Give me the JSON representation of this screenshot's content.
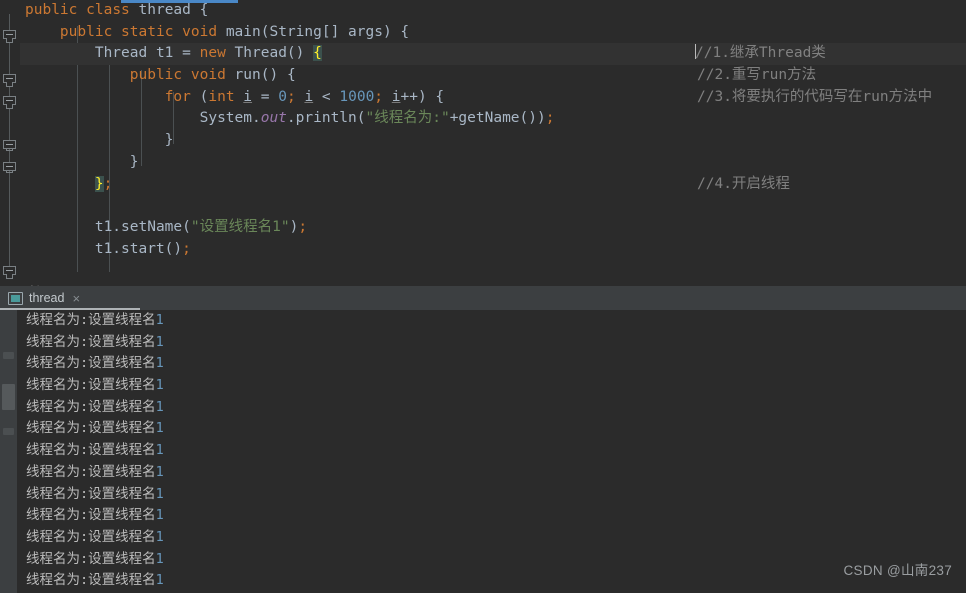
{
  "editor": {
    "tab_indicator_color": "#4a88c7",
    "background": "#2b2b2b",
    "language": "java",
    "code_lines": [
      {
        "indent": 0,
        "text": "public class thread {"
      },
      {
        "indent": 1,
        "text": "public static void main(String[] args) {"
      },
      {
        "indent": 2,
        "text": "Thread t1 = new Thread() {"
      },
      {
        "indent": 3,
        "text": "public void run() {"
      },
      {
        "indent": 4,
        "text": "for (int i = 0; i < 1000; i++) {"
      },
      {
        "indent": 5,
        "text": "System.out.println(\"线程名为:\"+getName());"
      },
      {
        "indent": 4,
        "text": "}"
      },
      {
        "indent": 3,
        "text": "}"
      },
      {
        "indent": 2,
        "text": "};"
      },
      {
        "indent": 0,
        "text": ""
      },
      {
        "indent": 2,
        "text": "t1.setName(\"设置线程名1\");"
      },
      {
        "indent": 2,
        "text": "t1.start();"
      },
      {
        "indent": 0,
        "text": "/*"
      }
    ],
    "side_comments": [
      {
        "line": 2,
        "text": "//1.继承Thread类"
      },
      {
        "line": 3,
        "text": "//2.重写run方法"
      },
      {
        "line": 4,
        "text": "//3.将要执行的代码写在run方法中"
      },
      {
        "line": 8,
        "text": "//4.开启线程"
      }
    ],
    "string_literals": {
      "println_arg": "线程名为:",
      "set_name_arg": "设置线程名1"
    },
    "loop_bound": "1000",
    "loop_init": "0",
    "class_name": "thread",
    "method_name": "main",
    "variable_name": "t1",
    "colors": {
      "keyword": "#cc7832",
      "string": "#6a8759",
      "number": "#6897bb",
      "field": "#9876aa",
      "comment": "#808080",
      "plain": "#a9b7c6",
      "brace_match_bg": "#3b514d",
      "brace_match_fg": "#ffef28",
      "current_line_bg": "#323232"
    }
  },
  "console": {
    "tab": {
      "label": "thread",
      "icon": "console-window-icon",
      "close_label": "×",
      "active": true
    },
    "output_line_text_prefix": "线程名为:设置线程名",
    "output_line_text_suffix": "1",
    "output_line_count": 13,
    "background": "#2b2b2b"
  },
  "watermark": {
    "text": "CSDN @山南237"
  }
}
